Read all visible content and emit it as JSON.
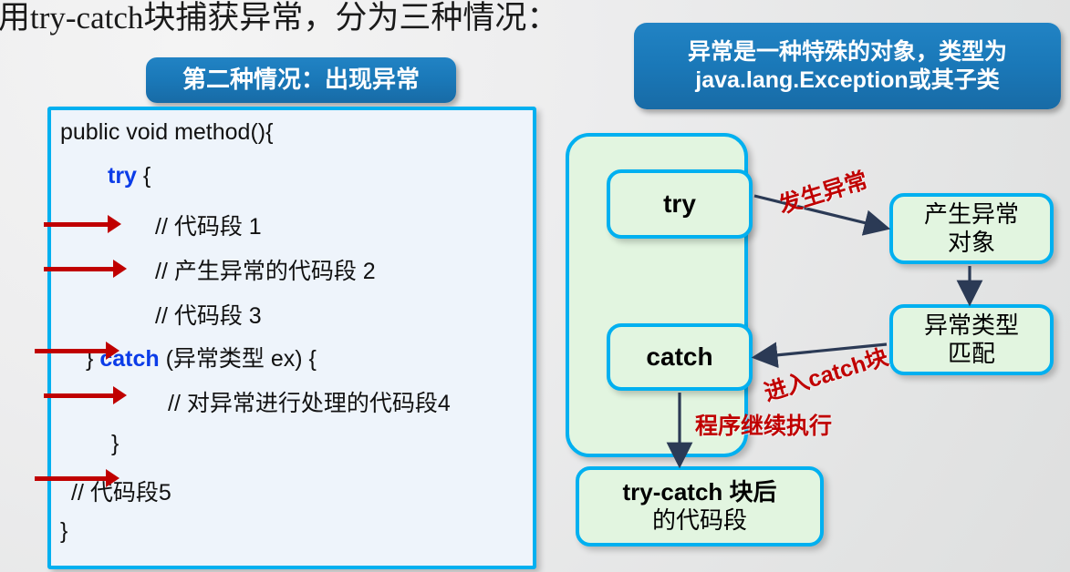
{
  "page": {
    "title": "用try-catch块捕获异常，分为三种情况："
  },
  "banners": {
    "case_label": "第二种情况：出现异常",
    "exception_note": {
      "line1": "异常是一种特殊的对象，类型为",
      "line2": "java.lang.Exception或其子类"
    }
  },
  "code_panel": {
    "lines": [
      {
        "text": "public void method(){",
        "indent": 0,
        "arrow": false
      },
      {
        "text": "try {",
        "indent": 1,
        "arrow": false,
        "keyword": "try"
      },
      {
        "text": "// 代码段 1",
        "indent": 2,
        "arrow": true
      },
      {
        "text": "// 产生异常的代码段 2",
        "indent": 2,
        "arrow": true
      },
      {
        "text": "// 代码段 3",
        "indent": 2,
        "arrow": false
      },
      {
        "text": "} catch (异常类型 ex) {",
        "indent": 1,
        "arrow": true,
        "keyword": "catch"
      },
      {
        "text": "// 对异常进行处理的代码段4",
        "indent": 2,
        "arrow": true
      },
      {
        "text": "}",
        "indent": 1,
        "arrow": false
      },
      {
        "text": "// 代码段5",
        "indent": 0,
        "arrow": true
      },
      {
        "text": "}",
        "indent": 0,
        "arrow": false
      }
    ],
    "l0": "public void method(){",
    "l1_kw": "try",
    "l1_rest": "{",
    "l2": "// 代码段 1",
    "l3": "// 产生异常的代码段 2",
    "l4": "// 代码段 3",
    "l5_pre": "}",
    "l5_kw": "catch",
    "l5_rest": "(异常类型 ex) {",
    "l6": "// 对异常进行处理的代码段4",
    "l7": "}",
    "l8": "// 代码段5",
    "l9": "}"
  },
  "flowchart": {
    "try_box": "try",
    "catch_box": "catch",
    "throw_box": {
      "line1": "产生异常",
      "line2": "对象"
    },
    "match_box": {
      "line1": "异常类型",
      "line2": "匹配"
    },
    "after_box": {
      "line1": "try-catch 块后",
      "line2": "的代码段"
    },
    "edge_labels": {
      "occur": "发生异常",
      "enter_catch": "进入catch块",
      "continue": "程序继续执行"
    }
  },
  "colors": {
    "banner_blue": "#1a78b8",
    "box_border_cyan": "#00b0f0",
    "box_fill_green": "#e2f5e0",
    "code_fill": "#eef4fb",
    "keyword_blue": "#0b3ce8",
    "red_arrow": "#c00000",
    "label_red": "#c00000",
    "flow_arrow": "#2b3a55",
    "background": "#e9eaea"
  }
}
